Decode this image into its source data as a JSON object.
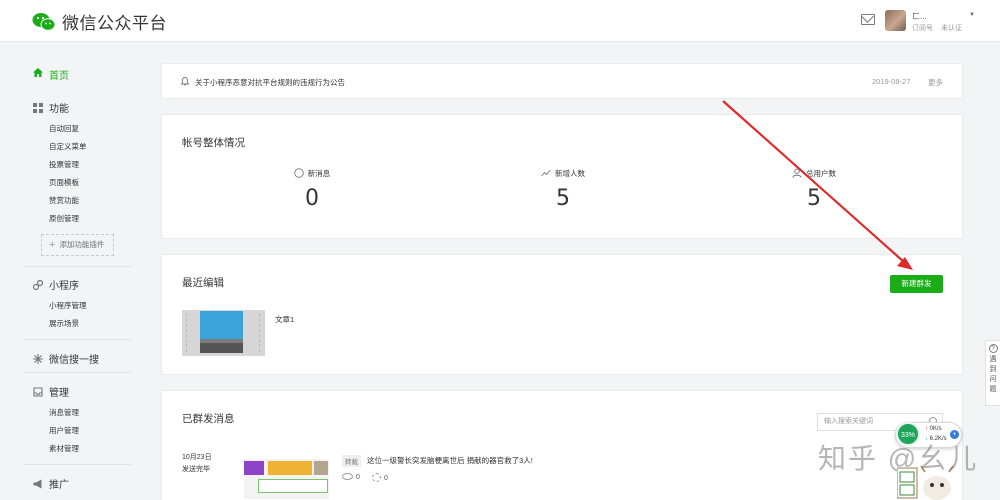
{
  "brand": {
    "title": "微信公众平台"
  },
  "user": {
    "name": "ㄈ...",
    "type": "订阅号",
    "verify": "未认证"
  },
  "sidebar": {
    "home": "首页",
    "feature": {
      "label": "功能",
      "items": [
        "自动回复",
        "自定义菜单",
        "投票管理",
        "页面模板",
        "赞赏功能",
        "原创管理"
      ],
      "add": "添加功能插件"
    },
    "miniprogram": {
      "label": "小程序",
      "items": [
        "小程序管理",
        "展示场景"
      ]
    },
    "search": {
      "label": "微信搜一搜"
    },
    "manage": {
      "label": "管理",
      "items": [
        "消息管理",
        "用户管理",
        "素材管理"
      ]
    },
    "promote": {
      "label": "推广"
    }
  },
  "notice": {
    "text": "关于小程序恶意对抗平台规则的违规行为公告",
    "date": "2019-08-27",
    "more": "更多"
  },
  "overview": {
    "title": "帐号整体情况",
    "stats": [
      {
        "label": "新消息",
        "value": "0",
        "icon": "chat-bubble-icon"
      },
      {
        "label": "新增人数",
        "value": "5",
        "icon": "trend-line-icon"
      },
      {
        "label": "总用户数",
        "value": "5",
        "icon": "user-icon"
      }
    ]
  },
  "recent": {
    "title": "最近编辑",
    "button": "新建群发",
    "article": "文章1"
  },
  "sent": {
    "title": "已群发消息",
    "search_placeholder": "输入搜索关键词",
    "message": {
      "date": "10月23日",
      "status": "发送完毕",
      "tag": "转载",
      "title": "这位一级警长突发脑梗离世后 捐献的器官救了3人!",
      "reads": "0",
      "likes": "0"
    }
  },
  "help": {
    "label": "遇到问题"
  },
  "widget": {
    "percent": "33%",
    "up": "0K/s",
    "down": "6.2K/s",
    "plus": "+"
  },
  "watermark": {
    "text": "知乎 @幺儿"
  },
  "colors": {
    "brand_green": "#1aad19",
    "arrow_red": "#e02a2a"
  }
}
